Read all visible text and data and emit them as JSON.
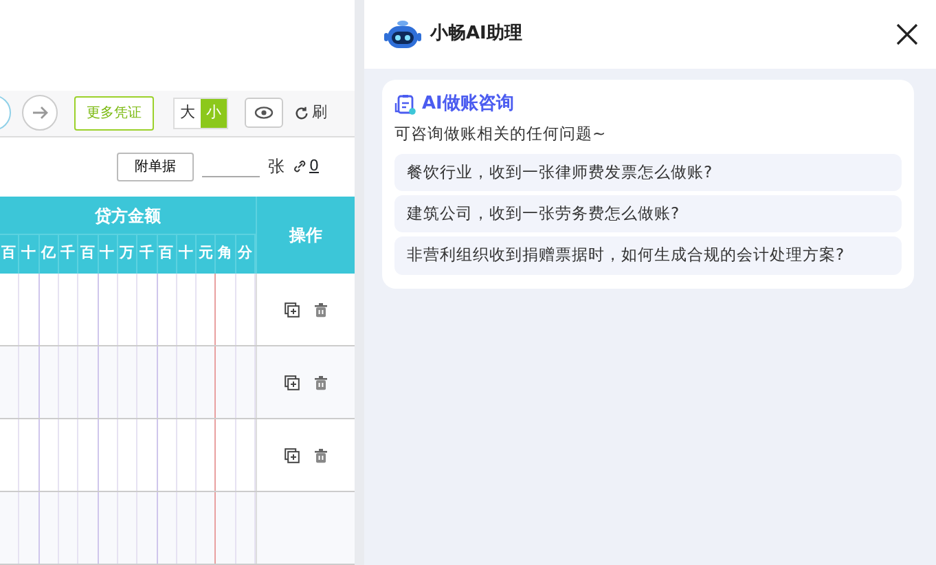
{
  "toolbar": {
    "more_vouchers": "更多凭证",
    "size_options": [
      {
        "label": "大",
        "selected": false
      },
      {
        "label": "小",
        "selected": true
      }
    ],
    "refresh": "刷"
  },
  "attachment": {
    "button": "附单据",
    "unit": "张",
    "link_count": "0"
  },
  "table": {
    "credit_header": "贷方金额",
    "action_header": "操作",
    "digit_columns": [
      "百",
      "十",
      "亿",
      "千",
      "百",
      "十",
      "万",
      "千",
      "百",
      "十",
      "元",
      "角",
      "分"
    ],
    "rows": [
      {
        "has_actions": true
      },
      {
        "has_actions": true
      },
      {
        "has_actions": true
      },
      {
        "has_actions": false
      }
    ]
  },
  "assistant": {
    "title": "小畅AI助理",
    "card_title": "AI做账咨询",
    "card_subtitle": "可咨询做账相关的任何问题~",
    "questions": [
      "餐饮行业，收到一张律师费发票怎么做账?",
      "建筑公司，收到一张劳务费怎么做账?",
      "非营利组织收到捐赠票据时，如何生成合规的会计处理方案?"
    ]
  }
}
